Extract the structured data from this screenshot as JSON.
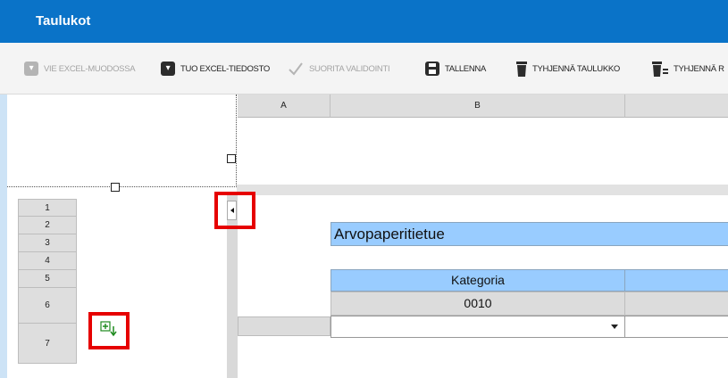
{
  "window": {
    "title": "Taulukot"
  },
  "toolbar": {
    "export_excel": "VIE EXCEL-MUODOSSA",
    "import_excel": "TUO EXCEL-TIEDOSTO",
    "validate": "SUORITA VALIDOINTI",
    "save": "TALLENNA",
    "clear_table": "TYHJENNÄ TAULUKKO",
    "clear_partial": "TYHJENNÄ R"
  },
  "columns": {
    "headers": [
      "A",
      "B"
    ]
  },
  "rows": {
    "headers": [
      "1",
      "2",
      "3",
      "4",
      "5",
      "6",
      "7"
    ]
  },
  "sheet": {
    "title": "Arvopaperitietue",
    "header_category": "Kategoria",
    "category_code": "0010"
  },
  "colors": {
    "titlebar": "#0a73c8",
    "cell_header": "#99ccff",
    "highlight": "#e60000"
  }
}
